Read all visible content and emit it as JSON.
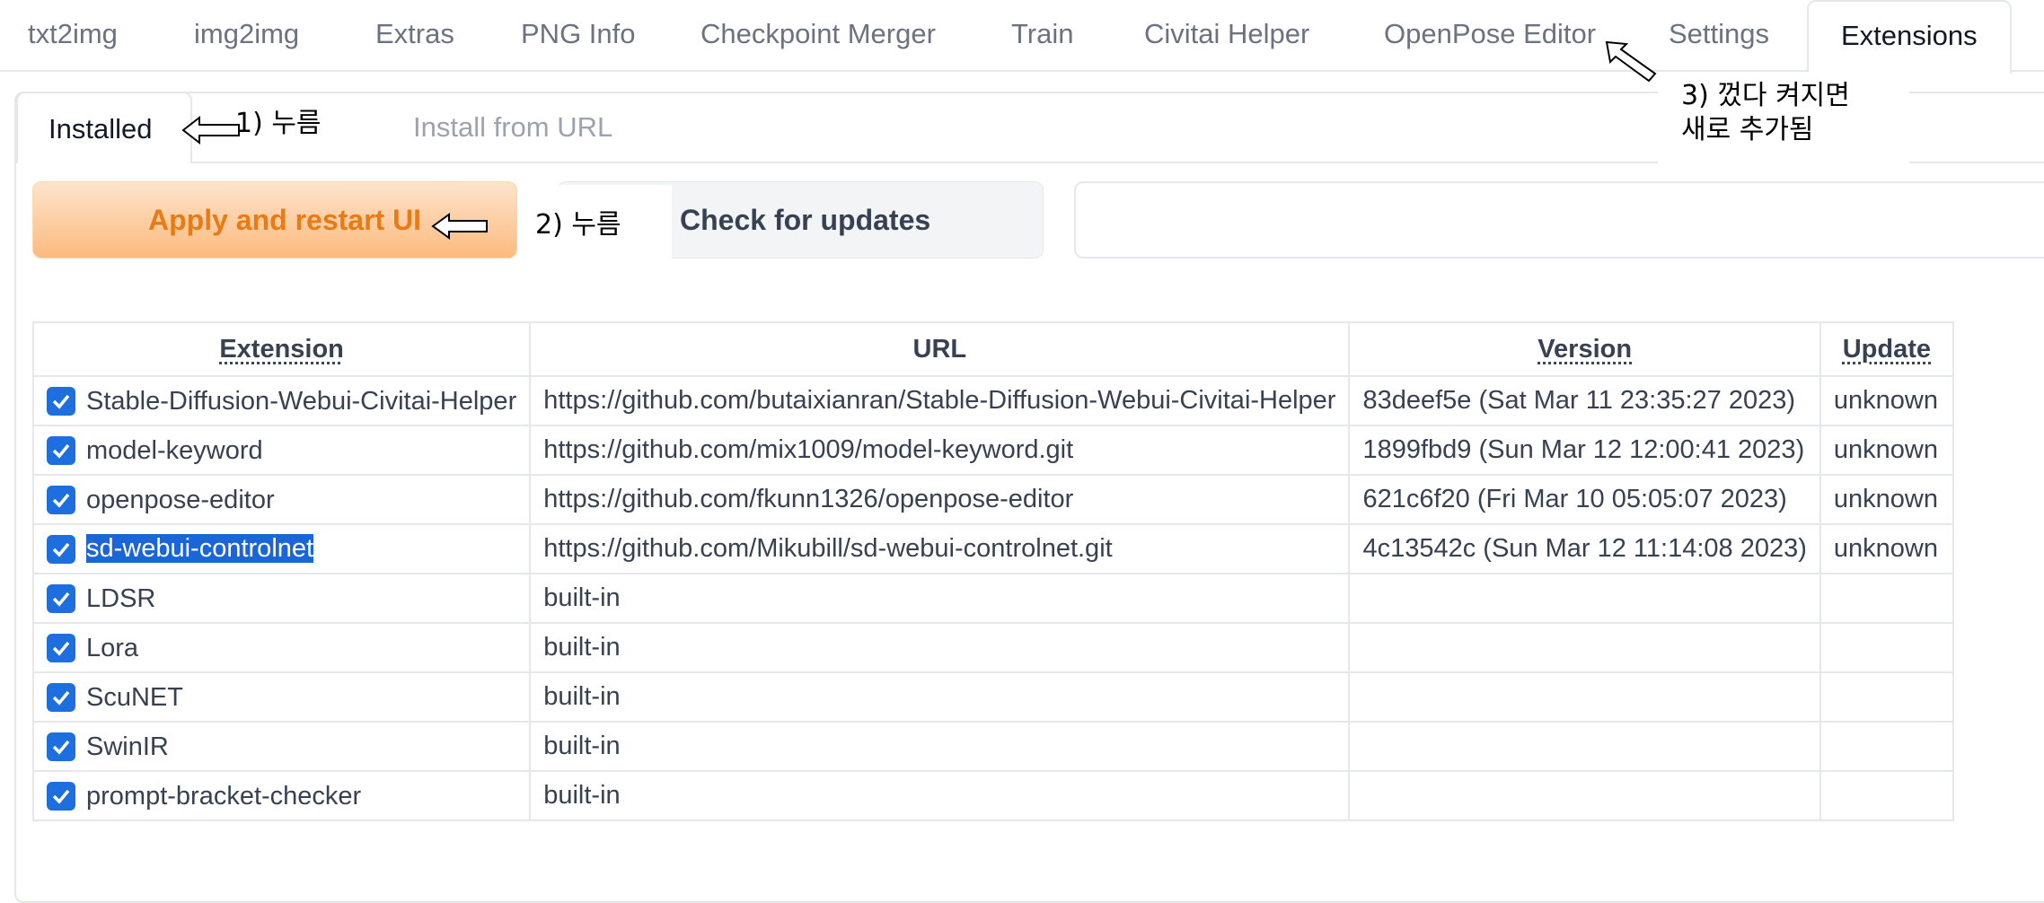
{
  "top_tabs": [
    {
      "label": "txt2img"
    },
    {
      "label": "img2img"
    },
    {
      "label": "Extras"
    },
    {
      "label": "PNG Info"
    },
    {
      "label": "Checkpoint Merger"
    },
    {
      "label": "Train"
    },
    {
      "label": "Civitai Helper"
    },
    {
      "label": "OpenPose Editor"
    },
    {
      "label": "Settings"
    },
    {
      "label": "Extensions",
      "active": true
    }
  ],
  "sub_tabs": [
    {
      "label": "Installed",
      "active": true
    },
    {
      "label": "Install from URL"
    }
  ],
  "buttons": {
    "apply": "Apply and restart UI",
    "check": "Check for updates"
  },
  "annotations": {
    "a1": "1) 누름",
    "a2": "2) 누름",
    "a3_line1": "3) 껐다 켜지면",
    "a3_line2": "새로 추가됨"
  },
  "table": {
    "headers": [
      "Extension",
      "URL",
      "Version",
      "Update"
    ],
    "rows": [
      {
        "checked": true,
        "name": "Stable-Diffusion-Webui-Civitai-Helper",
        "url": "https://github.com/butaixianran/Stable-Diffusion-Webui-Civitai-Helper",
        "version": "83deef5e (Sat Mar 11 23:35:27 2023)",
        "update": "unknown"
      },
      {
        "checked": true,
        "name": "model-keyword",
        "url": "https://github.com/mix1009/model-keyword.git",
        "version": "1899fbd9 (Sun Mar 12 12:00:41 2023)",
        "update": "unknown"
      },
      {
        "checked": true,
        "name": "openpose-editor",
        "url": "https://github.com/fkunn1326/openpose-editor",
        "version": "621c6f20 (Fri Mar 10 05:05:07 2023)",
        "update": "unknown"
      },
      {
        "checked": true,
        "name": "sd-webui-controlnet",
        "url": "https://github.com/Mikubill/sd-webui-controlnet.git",
        "version": "4c13542c (Sun Mar 12 11:14:08 2023)",
        "update": "unknown",
        "selected": true
      },
      {
        "checked": true,
        "name": "LDSR",
        "url": "built-in",
        "version": "",
        "update": ""
      },
      {
        "checked": true,
        "name": "Lora",
        "url": "built-in",
        "version": "",
        "update": ""
      },
      {
        "checked": true,
        "name": "ScuNET",
        "url": "built-in",
        "version": "",
        "update": ""
      },
      {
        "checked": true,
        "name": "SwinIR",
        "url": "built-in",
        "version": "",
        "update": ""
      },
      {
        "checked": true,
        "name": "prompt-bracket-checker",
        "url": "built-in",
        "version": "",
        "update": ""
      }
    ]
  },
  "colors": {
    "accent_orange": "#ea7a14",
    "checkbox_blue": "#1d6fe0",
    "selection_blue": "#1a66d9"
  }
}
